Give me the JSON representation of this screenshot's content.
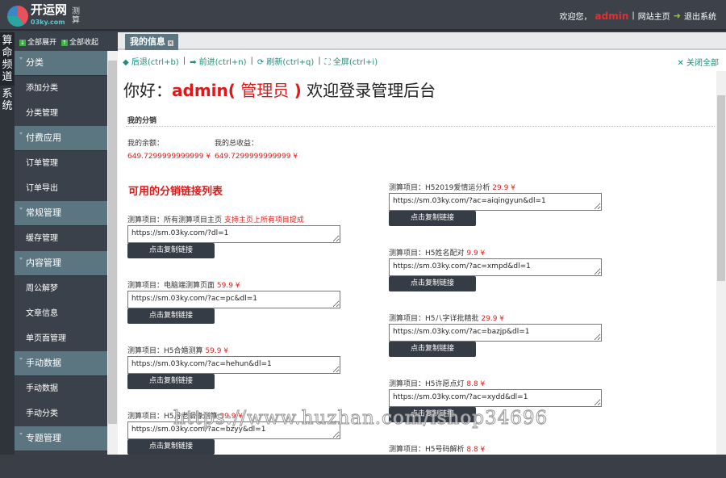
{
  "header": {
    "logo_text": "开运网",
    "logo_sub": "03ky.com",
    "logo_tag": "测算",
    "welcome": "欢迎您，",
    "user": "admin",
    "home_link": "网站主页",
    "logout": "退出系统"
  },
  "vnav": [
    {
      "label": "算命频道"
    },
    {
      "label": "系统"
    }
  ],
  "sidebar": {
    "expand_all": "全部展开",
    "collapse_all": "全部收起",
    "groups": [
      {
        "label": "分类",
        "items": [
          "添加分类",
          "分类管理"
        ]
      },
      {
        "label": "付费应用",
        "items": [
          "订单管理",
          "订单导出"
        ]
      },
      {
        "label": "常规管理",
        "items": [
          "缓存管理"
        ]
      },
      {
        "label": "内容管理",
        "items": [
          "周公解梦",
          "文章信息",
          "单页面管理"
        ]
      },
      {
        "label": "手动数据",
        "items": [
          "手动数据",
          "手动分类"
        ]
      },
      {
        "label": "专题管理",
        "items": []
      }
    ]
  },
  "tabs": [
    {
      "label": "我的信息"
    }
  ],
  "toolbar": {
    "back": "后退(ctrl+b)",
    "forward": "前进(ctrl+n)",
    "refresh": "刷新(ctrl+q)",
    "fullscreen": "全屏(ctrl+i)",
    "close_all": "关闭全部",
    "sep": "|"
  },
  "greeting": {
    "hello": "你好：",
    "user": "admin(",
    "role": " 管理员 ",
    "close": ")",
    "rest": " 欢迎登录管理后台"
  },
  "distribution": {
    "title": "我的分销",
    "balance_label": "我的余额：",
    "balance": "649.7299999999999 ¥",
    "income_label": "我的总收益：",
    "income": "649.7299999999999 ¥"
  },
  "links_title": "可用的分销链接列表",
  "copy_label": "点击复制链接",
  "links_left": [
    {
      "label": "测算项目：所有测算项目主页",
      "price": "支持主页上所有项目提成",
      "url": "https://sm.03ky.com/?dl=1"
    },
    {
      "label": "测算项目：电脑端测算页面",
      "price": "59.9 ¥",
      "url": "https://sm.03ky.com/?ac=pc&dl=1"
    },
    {
      "label": "测算项目：H5合婚测算",
      "price": "59.9 ¥",
      "url": "https://sm.03ky.com/?ac=hehun&dl=1"
    },
    {
      "label": "测算项目：H5月老姻缘测算",
      "price": "39.9 ¥",
      "url": "https://sm.03ky.com/?ac=bzyy&dl=1"
    }
  ],
  "links_right": [
    {
      "label": "测算项目：H52019爱情运分析",
      "price": "29.9 ¥",
      "url": "https://sm.03ky.com/?ac=aiqingyun&dl=1"
    },
    {
      "label": "测算项目：H5姓名配对",
      "price": "9.9 ¥",
      "url": "https://sm.03ky.com/?ac=xmpd&dl=1"
    },
    {
      "label": "测算项目：H5八字详批精批",
      "price": "29.9 ¥",
      "url": "https://sm.03ky.com/?ac=bazjp&dl=1"
    },
    {
      "label": "测算项目：H5许愿点灯",
      "price": "8.8 ¥",
      "url": "https://sm.03ky.com/?ac=xydd&dl=1"
    },
    {
      "label": "测算项目：H5号码解析",
      "price": "8.8 ¥",
      "url": ""
    }
  ],
  "watermark": "https://www.huzhan.com/ishop34696"
}
